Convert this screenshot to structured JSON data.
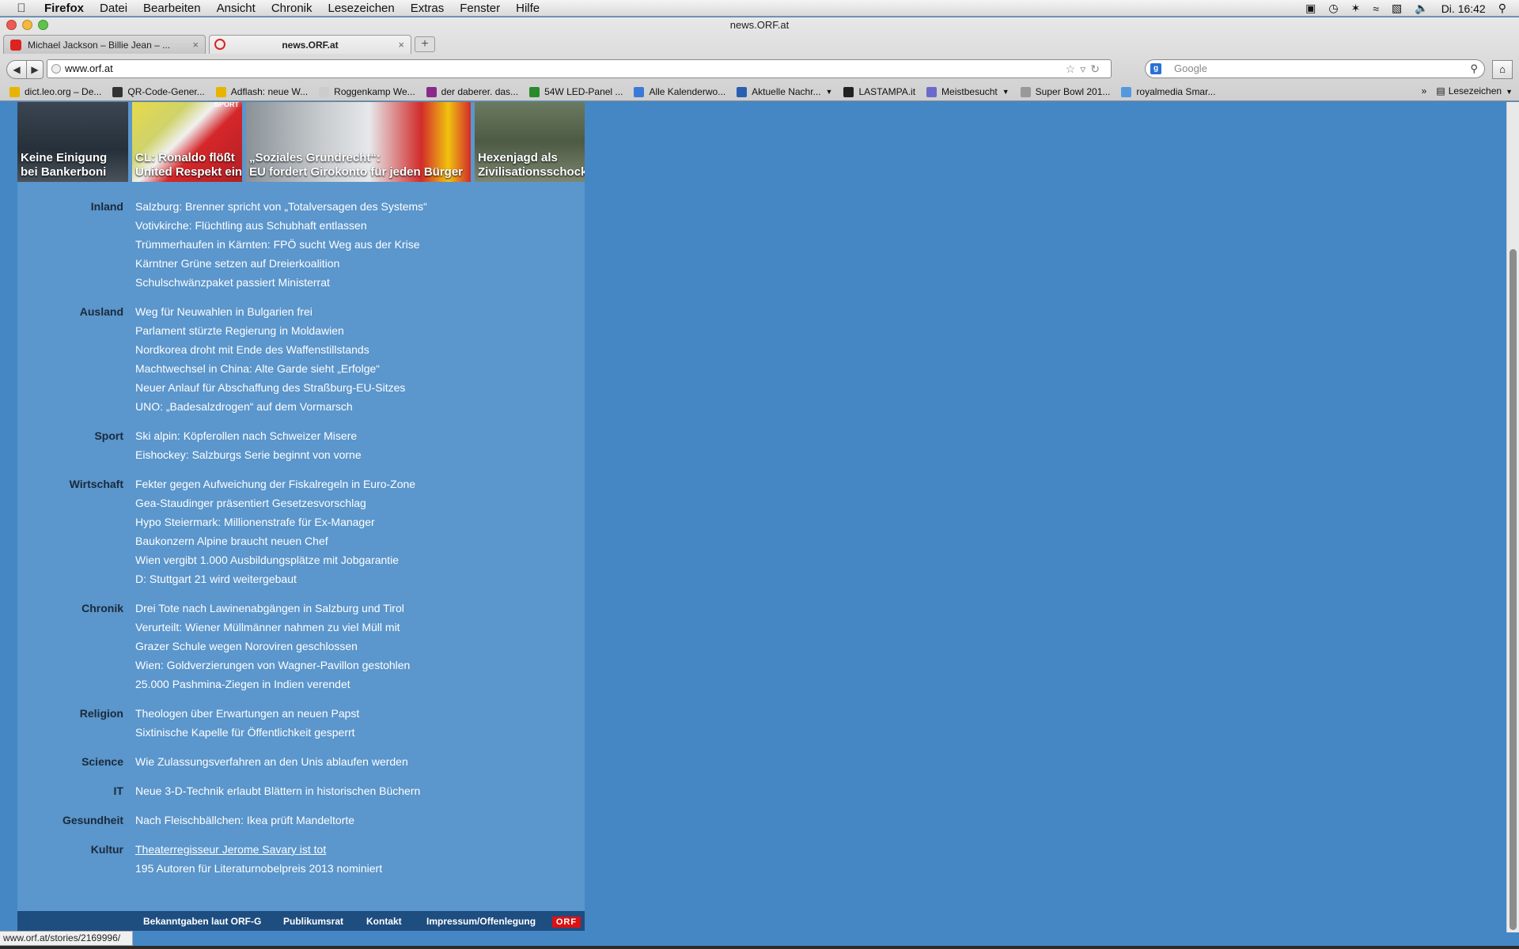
{
  "menubar": {
    "app": "Firefox",
    "items": [
      "Datei",
      "Bearbeiten",
      "Ansicht",
      "Chronik",
      "Lesezeichen",
      "Extras",
      "Fenster",
      "Hilfe"
    ],
    "clock": "Di. 16:42"
  },
  "window": {
    "title": "news.ORF.at"
  },
  "tabs": [
    {
      "label": "Michael Jackson – Billie Jean – ...",
      "close": "×"
    },
    {
      "label": "news.ORF.at",
      "close": "×"
    }
  ],
  "newtab": "+",
  "nav": {
    "back": "◀",
    "forward": "▶",
    "url": "www.orf.at",
    "search_placeholder": "Google",
    "home": "⌂"
  },
  "bookmarks": [
    {
      "label": "dict.leo.org – De...",
      "color": "#e8b400"
    },
    {
      "label": "QR-Code-Gener...",
      "color": "#333333"
    },
    {
      "label": "Adflash: neue W...",
      "color": "#e8b400"
    },
    {
      "label": "Roggenkamp We...",
      "color": "#cccccc"
    },
    {
      "label": "der daberer. das...",
      "color": "#8a2a8a"
    },
    {
      "label": "54W LED-Panel ...",
      "color": "#2a8a2a"
    },
    {
      "label": "Alle Kalenderwo...",
      "color": "#3a7ad6"
    },
    {
      "label": "Aktuelle Nachr...",
      "color": "#2a5fb0"
    },
    {
      "label": "LASTAMPA.it",
      "color": "#222222"
    },
    {
      "label": "Meistbesucht",
      "color": "#6a6acc"
    },
    {
      "label": "Super Bowl 201...",
      "color": "#999999"
    },
    {
      "label": "royalmedia Smar...",
      "color": "#5599dd"
    }
  ],
  "bookmarks_more": "Lesezeichen",
  "thumbs": [
    {
      "caption1": "Keine Einigung",
      "caption2": "bei Bankerboni"
    },
    {
      "caption1": "CL: Ronaldo flößt",
      "caption2": "United Respekt ein",
      "tag": "SPORT"
    },
    {
      "caption1": "„Soziales Grundrecht“:",
      "caption2": "EU fordert Girokonto für jeden Bürger"
    },
    {
      "caption1": "Hexenjagd als",
      "caption2": "Zivilisationsschock"
    }
  ],
  "sections": [
    {
      "label": "Inland",
      "items": [
        "Salzburg: Brenner spricht von „Totalversagen des Systems“",
        "Votivkirche: Flüchtling aus Schubhaft entlassen",
        "Trümmerhaufen in Kärnten: FPÖ sucht Weg aus der Krise",
        "Kärntner Grüne setzen auf Dreierkoalition",
        "Schulschwänzpaket passiert Ministerrat"
      ]
    },
    {
      "label": "Ausland",
      "items": [
        "Weg für Neuwahlen in Bulgarien frei",
        "Parlament stürzte Regierung in Moldawien",
        "Nordkorea droht mit Ende des Waffenstillstands",
        "Machtwechsel in China: Alte Garde sieht „Erfolge“",
        "Neuer Anlauf für Abschaffung des Straßburg-EU-Sitzes",
        "UNO: „Badesalzdrogen“ auf dem Vormarsch"
      ]
    },
    {
      "label": "Sport",
      "items": [
        "Ski alpin: Köpferollen nach Schweizer Misere",
        "Eishockey: Salzburgs Serie beginnt von vorne"
      ]
    },
    {
      "label": "Wirtschaft",
      "items": [
        "Fekter gegen Aufweichung der Fiskalregeln in Euro-Zone",
        "Gea-Staudinger präsentiert Gesetzesvorschlag",
        "Hypo Steiermark: Millionenstrafe für Ex-Manager",
        "Baukonzern Alpine braucht neuen Chef",
        "Wien vergibt 1.000 Ausbildungsplätze mit Jobgarantie",
        "D: Stuttgart 21 wird weitergebaut"
      ]
    },
    {
      "label": "Chronik",
      "items": [
        "Drei Tote nach Lawinenabgängen in Salzburg und Tirol",
        "Verurteilt: Wiener Müllmänner nahmen zu viel Müll mit",
        "Grazer Schule wegen Noroviren geschlossen",
        "Wien: Goldverzierungen von Wagner-Pavillon gestohlen",
        "25.000 Pashmina-Ziegen in Indien verendet"
      ]
    },
    {
      "label": "Religion",
      "items": [
        "Theologen über Erwartungen an neuen Papst",
        "Sixtinische Kapelle für Öffentlichkeit gesperrt"
      ]
    },
    {
      "label": "Science",
      "items": [
        "Wie Zulassungsverfahren an den Unis ablaufen werden"
      ]
    },
    {
      "label": "IT",
      "items": [
        "Neue 3-D-Technik erlaubt Blättern in historischen Büchern"
      ]
    },
    {
      "label": "Gesundheit",
      "items": [
        "Nach Fleischbällchen: Ikea prüft Mandeltorte"
      ]
    },
    {
      "label": "Kultur",
      "items": [
        "Theaterregisseur Jerome Savary ist tot",
        "195 Autoren für Literaturnobelpreis 2013 nominiert"
      ]
    }
  ],
  "hovered_item": "Theaterregisseur Jerome Savary ist tot",
  "footer": {
    "links": [
      "Bekanntgaben laut ORF-G",
      "Publikumsrat",
      "Kontakt",
      "Impressum/Offenlegung"
    ],
    "logo": "ORF"
  },
  "statusbar": {
    "url": "www.orf.at/stories/2169996/"
  },
  "colors": {
    "page_bg": "#4487c4",
    "news_panel": "#5b96cc",
    "footer": "#1e4d80",
    "orf_red": "#dd1111"
  }
}
